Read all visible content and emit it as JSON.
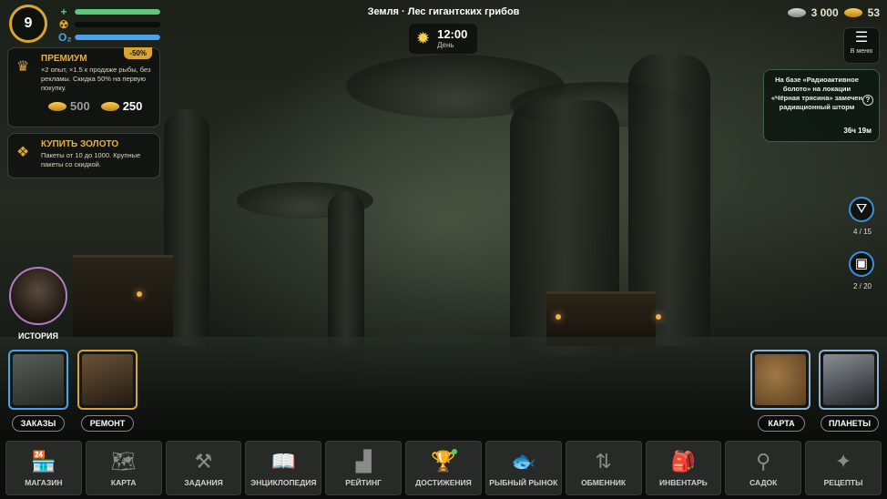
{
  "player": {
    "level": "9"
  },
  "stats": [
    {
      "icon": "health-icon",
      "glyph": "+",
      "color": "#5fc779",
      "fill": 1.0
    },
    {
      "icon": "radiation-icon",
      "glyph": "☢",
      "color": "#d9a431",
      "fill": 0.0
    },
    {
      "icon": "oxygen-icon",
      "glyph": "O₂",
      "color": "#4aa3e8",
      "fill": 1.0
    }
  ],
  "premium": {
    "badge": "-50%",
    "title": "ПРЕМИУМ",
    "text": "×2 опыт, ×1.5 к продаже рыбы, без рекламы. Скидка 50% на первую покупку.",
    "old_price": "500",
    "new_price": "250"
  },
  "gold_offer": {
    "title": "КУПИТЬ ЗОЛОТО",
    "text": "Пакеты от 10 до 1000. Крупные пакеты со скидкой."
  },
  "location": "Земля · Лес гигантских грибов",
  "clock": {
    "time": "12:00",
    "label": "День"
  },
  "currency": {
    "silver": "3 000",
    "gold": "53"
  },
  "menu": {
    "label": "В меню"
  },
  "notice": {
    "text": "На базе «Радиоактивное болото» на локации «Чёрная трясина» замечен радиационный шторм",
    "help": "?",
    "timer": "36ч 19м"
  },
  "side_widgets": [
    {
      "icon": "fishing-net-icon",
      "count": "4 / 15"
    },
    {
      "icon": "robot-icon",
      "count": "2 / 20"
    }
  ],
  "story": {
    "label": "ИСТОРИЯ"
  },
  "left_tiles": [
    {
      "label": "ЗАКАЗЫ",
      "border": "#4aa3e8"
    },
    {
      "label": "РЕМОНТ",
      "border": "#d9a431"
    }
  ],
  "right_tiles": [
    {
      "label": "КАРТА",
      "border": "#8fb3cf"
    },
    {
      "label": "ПЛАНЕТЫ",
      "border": "#8fb3cf"
    }
  ],
  "nav": [
    {
      "label": "МАГАЗИН",
      "icon": "shop-icon",
      "glyph": "🏪"
    },
    {
      "label": "КАРТА",
      "icon": "map-icon",
      "glyph": "🗺"
    },
    {
      "label": "ЗАДАНИЯ",
      "icon": "quests-icon",
      "glyph": "⚒"
    },
    {
      "label": "ЭНЦИКЛОПЕДИЯ",
      "icon": "encyclopedia-icon",
      "glyph": "📖"
    },
    {
      "label": "РЕЙТИНГ",
      "icon": "rating-icon",
      "glyph": "▟"
    },
    {
      "label": "ДОСТИЖЕНИЯ",
      "icon": "trophy-icon",
      "glyph": "🏆"
    },
    {
      "label": "РЫБНЫЙ РЫНОК",
      "icon": "fish-market-icon",
      "glyph": "🐟"
    },
    {
      "label": "ОБМЕННИК",
      "icon": "exchange-icon",
      "glyph": "⇅"
    },
    {
      "label": "ИНВЕНТАРЬ",
      "icon": "inventory-icon",
      "glyph": "🎒"
    },
    {
      "label": "САДОК",
      "icon": "keepnet-icon",
      "glyph": "⚲"
    },
    {
      "label": "РЕЦЕПТЫ",
      "icon": "recipes-icon",
      "glyph": "✦"
    }
  ]
}
